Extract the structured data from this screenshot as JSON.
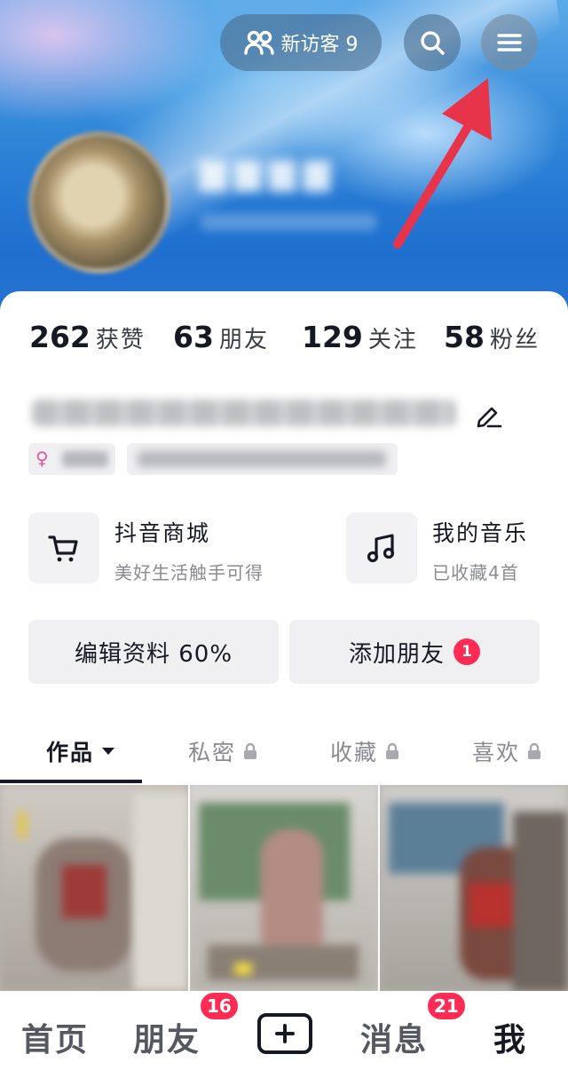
{
  "header": {
    "visitor_label": "新访客 9",
    "search_icon": "search-icon",
    "menu_icon": "menu-icon"
  },
  "stats": [
    {
      "value": "262",
      "label": "获赞"
    },
    {
      "value": "63",
      "label": "朋友"
    },
    {
      "value": "129",
      "label": "关注"
    },
    {
      "value": "58",
      "label": "粉丝"
    }
  ],
  "features": {
    "mall": {
      "title": "抖音商城",
      "subtitle": "美好生活触手可得",
      "icon": "cart-icon"
    },
    "music": {
      "title": "我的音乐",
      "subtitle": "已收藏4首",
      "icon": "music-note-icon"
    }
  },
  "buttons": {
    "edit_profile": "编辑资料 60%",
    "add_friends": "添加朋友",
    "add_friends_badge": "1"
  },
  "tabs": [
    {
      "label": "作品",
      "active": true
    },
    {
      "label": "私密",
      "locked": true
    },
    {
      "label": "收藏",
      "locked": true
    },
    {
      "label": "喜欢",
      "locked": true
    }
  ],
  "bottom_nav": {
    "home": "首页",
    "friends": "朋友",
    "friends_badge": "16",
    "messages": "消息",
    "messages_badge": "21",
    "me": "我"
  },
  "colors": {
    "accent_red": "#fe2c55",
    "annotation_arrow": "#e8344a",
    "text_primary": "#161823",
    "text_secondary": "#8a8b91"
  }
}
